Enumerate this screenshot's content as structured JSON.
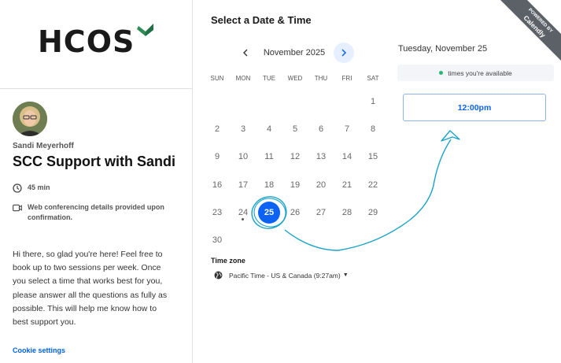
{
  "org": {
    "logo_text": "HCOS"
  },
  "host": {
    "name": "Sandi Meyerhoff"
  },
  "event": {
    "title": "SCC Support with Sandi",
    "duration": "45 min",
    "location_note": "Web conferencing details provided upon confirmation.",
    "description": "Hi there, so glad you're here! Feel free to book up to two sessions per week. Once you select a time that works best for you, please answer all the questions as fully as possible. This will help me know how to best support you."
  },
  "footer": {
    "cookie_settings": "Cookie settings"
  },
  "calendar": {
    "heading": "Select a Date & Time",
    "month_label": "November 2025",
    "weekdays": [
      "SUN",
      "MON",
      "TUE",
      "WED",
      "THU",
      "FRI",
      "SAT"
    ],
    "days": [
      "1",
      "2",
      "3",
      "4",
      "5",
      "6",
      "7",
      "8",
      "9",
      "10",
      "11",
      "12",
      "13",
      "14",
      "15",
      "16",
      "17",
      "18",
      "19",
      "20",
      "21",
      "22",
      "23",
      "24",
      "25",
      "26",
      "27",
      "28",
      "29",
      "30"
    ],
    "selected_day": "25",
    "today_marker_day": "24"
  },
  "timezone": {
    "label": "Time zone",
    "value": "Pacific Time - US & Canada (9:27am)"
  },
  "slots": {
    "date_heading": "Tuesday, November 25",
    "availability_note": "times you're available",
    "times": [
      "12:00pm"
    ]
  },
  "badge": {
    "line1": "POWERED BY",
    "line2": "Calendly"
  },
  "colors": {
    "accent": "#0b62f5",
    "logo_green": "#2e8b57",
    "annotation": "#1aa3c8",
    "available_dot": "#2bb673"
  }
}
